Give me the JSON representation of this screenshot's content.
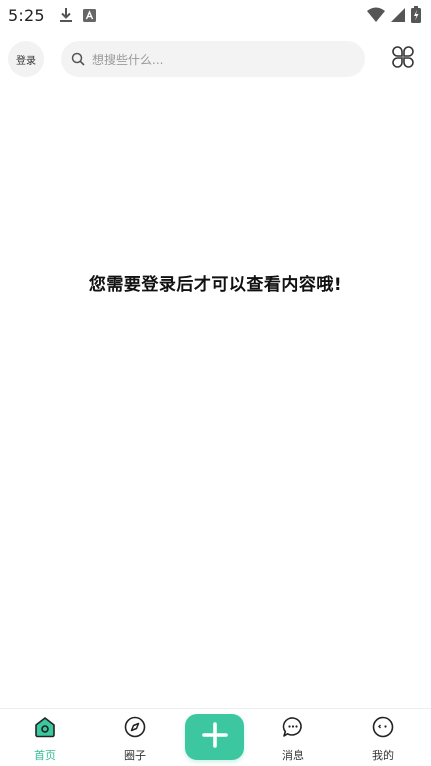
{
  "status_bar": {
    "time": "5:25",
    "icons_left": [
      "download-icon",
      "a-notification-icon"
    ],
    "icons_right": [
      "wifi-icon",
      "cell-signal-icon",
      "battery-charging-icon"
    ]
  },
  "header": {
    "login_label": "登录",
    "search": {
      "placeholder": "想搜些什么..."
    }
  },
  "main": {
    "message": "您需要登录后才可以查看内容哦!"
  },
  "bottom_nav": {
    "items": [
      {
        "label": "首页",
        "icon": "home-icon",
        "active": true
      },
      {
        "label": "圈子",
        "icon": "compass-icon",
        "active": false
      },
      {
        "label": "消息",
        "icon": "chat-bubble-icon",
        "active": false
      },
      {
        "label": "我的",
        "icon": "face-icon",
        "active": false
      }
    ],
    "add_icon": "plus-icon"
  },
  "colors": {
    "accent": "#3cc7a0",
    "active_label": "#2fbf95",
    "search_bg": "#f3f3f3"
  }
}
